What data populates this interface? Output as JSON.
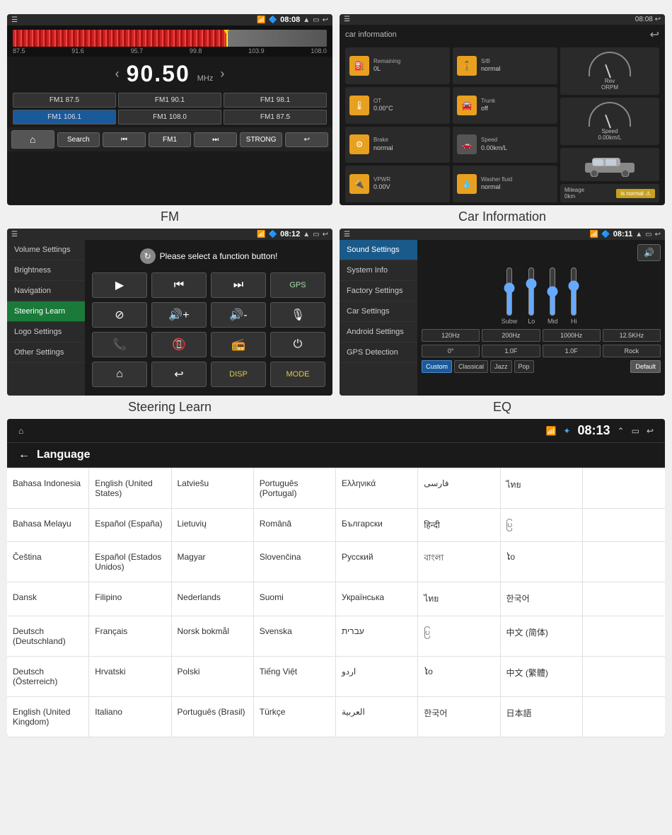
{
  "fm": {
    "statusbar": {
      "left_icon": "☰",
      "wifi": "WiFi",
      "bt": "BT",
      "time": "08:08",
      "signal": "▲",
      "battery": "▭",
      "back": "↩"
    },
    "freq_labels": [
      "87.5",
      "91.6",
      "95.7",
      "99.8",
      "103.9",
      "108.0"
    ],
    "current_freq": "90.50",
    "freq_unit": "MHz",
    "presets": [
      {
        "label": "FM1 87.5",
        "active": false
      },
      {
        "label": "FM1 90.1",
        "active": false
      },
      {
        "label": "FM1 98.1",
        "active": false
      },
      {
        "label": "FM1 106.1",
        "active": false
      },
      {
        "label": "FM1 108.0",
        "active": false
      },
      {
        "label": "FM1 87.5",
        "active": false
      }
    ],
    "controls": [
      "🏠",
      "Search",
      "⏮",
      "FM1",
      "⏭",
      "STRONG",
      "↩"
    ],
    "label": "FM"
  },
  "car_info": {
    "title": "car information",
    "statusbar_time": "08:08",
    "cells": [
      {
        "icon": "⛽",
        "label": "Remaining",
        "value": "0L"
      },
      {
        "icon": "🧍",
        "label": "S/B",
        "value": "normal"
      },
      {
        "icon": "🌡",
        "label": "OT",
        "value": "0.00°C"
      },
      {
        "icon": "🚗",
        "label": "Trunk",
        "value": "off"
      },
      {
        "icon": "⚙",
        "label": "Brake",
        "value": "normal"
      },
      {
        "icon": "💨",
        "label": "Speed",
        "value": "0.00km/L"
      }
    ],
    "vpwr_label": "VPWR",
    "vpwr_value": "0.00V",
    "washer_label": "Washer fluid",
    "washer_value": "normal",
    "mileage_label": "Mileage",
    "mileage_value": "0km",
    "rev_label": "Rev ORPM",
    "is_normal": "is normal",
    "label": "Car Information"
  },
  "steering": {
    "statusbar_time": "08:12",
    "prompt": "Please select a function button!",
    "sidebar_items": [
      {
        "label": "Volume Settings",
        "active": false
      },
      {
        "label": "Brightness",
        "active": false
      },
      {
        "label": "Navigation",
        "active": false
      },
      {
        "label": "Steering Learn",
        "active": true
      },
      {
        "label": "Logo Settings",
        "active": false
      },
      {
        "label": "Other Settings",
        "active": false
      }
    ],
    "buttons": [
      {
        "symbol": "▶",
        "type": "icon"
      },
      {
        "symbol": "⏮",
        "type": "icon"
      },
      {
        "symbol": "⏭",
        "type": "icon"
      },
      {
        "symbol": "GPS",
        "type": "text"
      },
      {
        "symbol": "🚫",
        "type": "icon"
      },
      {
        "symbol": "🔊+",
        "type": "icon"
      },
      {
        "symbol": "🔊-",
        "type": "icon"
      },
      {
        "symbol": "🎙",
        "type": "icon"
      },
      {
        "symbol": "📞",
        "type": "icon"
      },
      {
        "symbol": "📞↩",
        "type": "icon"
      },
      {
        "symbol": "📻",
        "type": "icon"
      },
      {
        "symbol": "⏻",
        "type": "icon"
      },
      {
        "symbol": "🏠",
        "type": "icon"
      },
      {
        "symbol": "↩",
        "type": "icon"
      },
      {
        "symbol": "DISP",
        "type": "text"
      },
      {
        "symbol": "MODE",
        "type": "text"
      }
    ],
    "label": "Steering Learn"
  },
  "eq": {
    "statusbar_time": "08:11",
    "sidebar_items": [
      {
        "label": "Sound Settings",
        "active": true
      },
      {
        "label": "System Info",
        "active": false
      },
      {
        "label": "Factory Settings",
        "active": false
      },
      {
        "label": "Car Settings",
        "active": false
      },
      {
        "label": "Android Settings",
        "active": false
      },
      {
        "label": "GPS Detection",
        "active": false
      }
    ],
    "sliders": [
      {
        "label": "Subw",
        "value": 60
      },
      {
        "label": "Lo",
        "value": 70
      },
      {
        "label": "Mid",
        "value": 50
      },
      {
        "label": "Hi",
        "value": 65
      }
    ],
    "freq_buttons": [
      "120Hz",
      "200Hz",
      "1000Hz",
      "12.5KHz"
    ],
    "phase_buttons": [
      "0°",
      "1.0F",
      "1.0F",
      "Rock"
    ],
    "preset_buttons": [
      {
        "label": "Custom",
        "active": true
      },
      {
        "label": "Classical",
        "active": false
      },
      {
        "label": "Jazz",
        "active": false
      },
      {
        "label": "Pop",
        "active": false
      }
    ],
    "default_btn": "Default",
    "speaker_btn": "🔊",
    "label": "EQ"
  },
  "language": {
    "statusbar_time": "08:13",
    "title": "Language",
    "back_arrow": "←",
    "languages": [
      "Bahasa Indonesia",
      "English (United States)",
      "Latviešu",
      "Português (Portugal)",
      "Ελληνικά",
      "فارسی",
      "ไทย",
      "Bahasa Melayu",
      "Español (España)",
      "Lietuvių",
      "Română",
      "Български",
      "हिन्दी",
      "ပြ",
      "Čeština",
      "Español (Estados Unidos)",
      "Magyar",
      "Slovenčina",
      "Русский",
      "বাংলা",
      "ไo",
      "Dansk",
      "Filipino",
      "Nederlands",
      "Suomi",
      "Українська",
      "ไทย",
      "한국어",
      "Deutsch (Deutschland)",
      "Français",
      "Norsk bokmål",
      "Svenska",
      "עברית",
      "ပြ",
      "中文 (简体)",
      "Deutsch (Österreich)",
      "Hrvatski",
      "Polski",
      "Tiếng Việt",
      "اردو",
      "ไo",
      "中文 (繁體)",
      "English (United Kingdom)",
      "Italiano",
      "Português (Brasil)",
      "Türkçe",
      "العربية",
      "한국어",
      "日本語"
    ]
  }
}
